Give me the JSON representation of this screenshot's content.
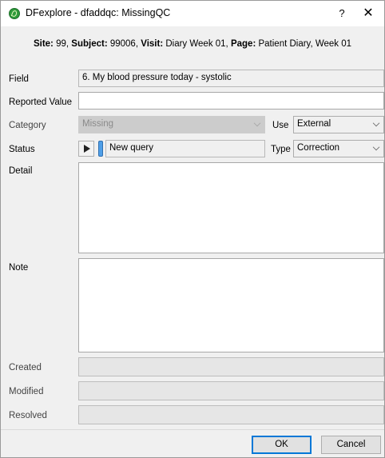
{
  "window": {
    "title": "DFexplore - dfaddqc: MissingQC",
    "help": "?",
    "close": "✕"
  },
  "header": {
    "site_label": "Site:",
    "site_value": " 99, ",
    "subject_label": "Subject:",
    "subject_value": " 99006, ",
    "visit_label": "Visit:",
    "visit_value": " Diary Week 01, ",
    "page_label": "Page:",
    "page_value": " Patient Diary, Week 01"
  },
  "form": {
    "field_label": "Field",
    "field_value": "6. My blood pressure today - systolic",
    "reported_value_label": "Reported Value",
    "reported_value": "",
    "category_label": "Category",
    "category_value": "Missing",
    "use_label": "Use",
    "use_value": "External",
    "status_label": "Status",
    "status_value": "New query",
    "type_label": "Type",
    "type_value": "Correction",
    "detail_label": "Detail",
    "detail_value": "",
    "note_label": "Note",
    "note_value": "",
    "created_label": "Created",
    "created_value": "",
    "modified_label": "Modified",
    "modified_value": "",
    "resolved_label": "Resolved",
    "resolved_value": ""
  },
  "buttons": {
    "ok": "OK",
    "cancel": "Cancel"
  }
}
